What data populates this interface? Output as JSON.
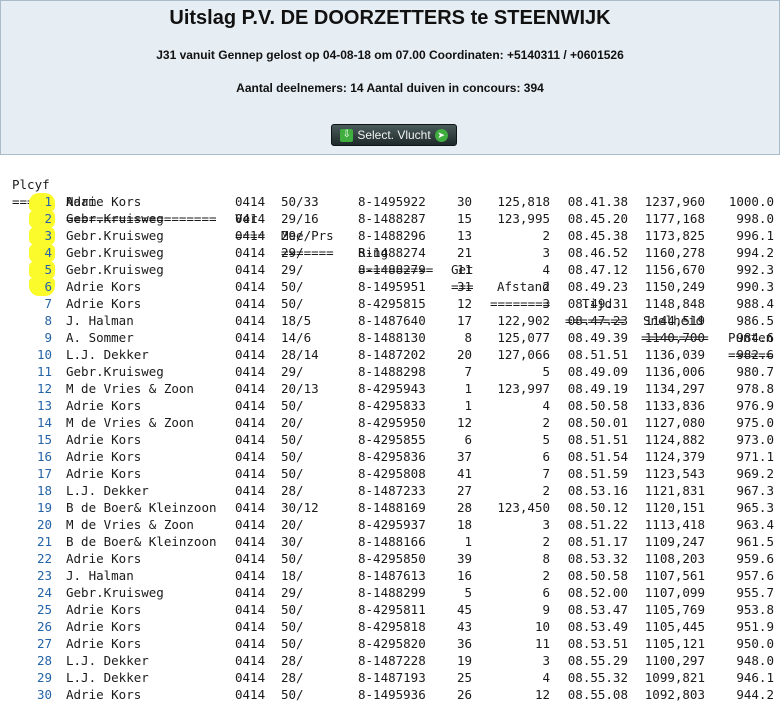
{
  "header": {
    "title": "Uitslag P.V. DE DOORZETTERS te STEENWIJK",
    "flight_info": "J31 vanuit Gennep gelost op 04-08-18 om 07.00 Coordinaten: +5140311 / +0601526",
    "participants": "Aantal deelnemers: 14 Aantal duiven in concours: 394"
  },
  "toolbar": {
    "select_label": "Select. Vlucht"
  },
  "table": {
    "headers": {
      "plcyf": "Plcyf",
      "naam": "Naam",
      "ver": "Ver",
      "mee": "Mee/Prs",
      "ring": "Ring",
      "get": "Get",
      "afstand": "Afstand",
      "tijd": "Tijd",
      "snelheid": "Snelheid",
      "punten": "Punten"
    },
    "separators": {
      "plcyf": "=====",
      "naam": "====================",
      "ver": "====",
      "mee": "=======",
      "ring": "==========",
      "get": "===",
      "afstand": "========",
      "tijd": "========",
      "snelheid": "=========",
      "punten": "======"
    },
    "rows": [
      {
        "rank": "1",
        "naam": "Adrie Kors",
        "ver": "0414",
        "mee": "50/33",
        "ring": "8-1495922",
        "get": "30",
        "afstand": "125,818",
        "tijd": "08.41.38",
        "snelheid": "1237,960",
        "punten": "1000.0"
      },
      {
        "rank": "2",
        "naam": "Gebr.Kruisweg",
        "ver": "0414",
        "mee": "29/16",
        "ring": "8-1488287",
        "get": "15",
        "afstand": "123,995",
        "tijd": "08.45.20",
        "snelheid": "1177,168",
        "punten": "998.0"
      },
      {
        "rank": "3",
        "naam": "Gebr.Kruisweg",
        "ver": "0414",
        "mee": "29/",
        "ring": "8-1488296",
        "get": "13",
        "afstand": "2",
        "tijd": "08.45.38",
        "snelheid": "1173,825",
        "punten": "996.1"
      },
      {
        "rank": "4",
        "naam": "Gebr.Kruisweg",
        "ver": "0414",
        "mee": "29/",
        "ring": "8-1488274",
        "get": "21",
        "afstand": "3",
        "tijd": "08.46.52",
        "snelheid": "1160,278",
        "punten": "994.2"
      },
      {
        "rank": "5",
        "naam": "Gebr.Kruisweg",
        "ver": "0414",
        "mee": "29/",
        "ring": "8-1488279",
        "get": "11",
        "afstand": "4",
        "tijd": "08.47.12",
        "snelheid": "1156,670",
        "punten": "992.3"
      },
      {
        "rank": "6",
        "naam": "Adrie Kors",
        "ver": "0414",
        "mee": "50/",
        "ring": "8-1495951",
        "get": "31",
        "afstand": "2",
        "tijd": "08.49.23",
        "snelheid": "1150,249",
        "punten": "990.3"
      },
      {
        "rank": "7",
        "naam": "Adrie Kors",
        "ver": "0414",
        "mee": "50/",
        "ring": "8-4295815",
        "get": "12",
        "afstand": "3",
        "tijd": "08.49.31",
        "snelheid": "1148,848",
        "punten": "988.4"
      },
      {
        "rank": "8",
        "naam": "J. Halman",
        "ver": "0414",
        "mee": "18/5",
        "ring": "8-1487640",
        "get": "17",
        "afstand": "122,902",
        "tijd": "08.47.23",
        "snelheid": "1144,519",
        "punten": "986.5"
      },
      {
        "rank": "9",
        "naam": "A. Sommer",
        "ver": "0414",
        "mee": "14/6",
        "ring": "8-1488130",
        "get": "8",
        "afstand": "125,077",
        "tijd": "08.49.39",
        "snelheid": "1140,700",
        "punten": "984.6"
      },
      {
        "rank": "10",
        "naam": "L.J. Dekker",
        "ver": "0414",
        "mee": "28/14",
        "ring": "8-1487202",
        "get": "20",
        "afstand": "127,066",
        "tijd": "08.51.51",
        "snelheid": "1136,039",
        "punten": "982.6"
      },
      {
        "rank": "11",
        "naam": "Gebr.Kruisweg",
        "ver": "0414",
        "mee": "29/",
        "ring": "8-1488298",
        "get": "7",
        "afstand": "5",
        "tijd": "08.49.09",
        "snelheid": "1136,006",
        "punten": "980.7"
      },
      {
        "rank": "12",
        "naam": "M de Vries & Zoon",
        "ver": "0414",
        "mee": "20/13",
        "ring": "8-4295943",
        "get": "1",
        "afstand": "123,997",
        "tijd": "08.49.19",
        "snelheid": "1134,297",
        "punten": "978.8"
      },
      {
        "rank": "13",
        "naam": "Adrie Kors",
        "ver": "0414",
        "mee": "50/",
        "ring": "8-4295833",
        "get": "1",
        "afstand": "4",
        "tijd": "08.50.58",
        "snelheid": "1133,836",
        "punten": "976.9"
      },
      {
        "rank": "14",
        "naam": "M de Vries & Zoon",
        "ver": "0414",
        "mee": "20/",
        "ring": "8-4295950",
        "get": "12",
        "afstand": "2",
        "tijd": "08.50.01",
        "snelheid": "1127,080",
        "punten": "975.0"
      },
      {
        "rank": "15",
        "naam": "Adrie Kors",
        "ver": "0414",
        "mee": "50/",
        "ring": "8-4295855",
        "get": "6",
        "afstand": "5",
        "tijd": "08.51.51",
        "snelheid": "1124,882",
        "punten": "973.0"
      },
      {
        "rank": "16",
        "naam": "Adrie Kors",
        "ver": "0414",
        "mee": "50/",
        "ring": "8-4295836",
        "get": "37",
        "afstand": "6",
        "tijd": "08.51.54",
        "snelheid": "1124,379",
        "punten": "971.1"
      },
      {
        "rank": "17",
        "naam": "Adrie Kors",
        "ver": "0414",
        "mee": "50/",
        "ring": "8-4295808",
        "get": "41",
        "afstand": "7",
        "tijd": "08.51.59",
        "snelheid": "1123,543",
        "punten": "969.2"
      },
      {
        "rank": "18",
        "naam": "L.J. Dekker",
        "ver": "0414",
        "mee": "28/",
        "ring": "8-1487233",
        "get": "27",
        "afstand": "2",
        "tijd": "08.53.16",
        "snelheid": "1121,831",
        "punten": "967.3"
      },
      {
        "rank": "19",
        "naam": "B de Boer& Kleinzoon",
        "ver": "0414",
        "mee": "30/12",
        "ring": "8-1488169",
        "get": "28",
        "afstand": "123,450",
        "tijd": "08.50.12",
        "snelheid": "1120,151",
        "punten": "965.3"
      },
      {
        "rank": "20",
        "naam": "M de Vries & Zoon",
        "ver": "0414",
        "mee": "20/",
        "ring": "8-4295937",
        "get": "18",
        "afstand": "3",
        "tijd": "08.51.22",
        "snelheid": "1113,418",
        "punten": "963.4"
      },
      {
        "rank": "21",
        "naam": "B de Boer& Kleinzoon",
        "ver": "0414",
        "mee": "30/",
        "ring": "8-1488166",
        "get": "1",
        "afstand": "2",
        "tijd": "08.51.17",
        "snelheid": "1109,247",
        "punten": "961.5"
      },
      {
        "rank": "22",
        "naam": "Adrie Kors",
        "ver": "0414",
        "mee": "50/",
        "ring": "8-4295850",
        "get": "39",
        "afstand": "8",
        "tijd": "08.53.32",
        "snelheid": "1108,203",
        "punten": "959.6"
      },
      {
        "rank": "23",
        "naam": "J. Halman",
        "ver": "0414",
        "mee": "18/",
        "ring": "8-1487613",
        "get": "16",
        "afstand": "2",
        "tijd": "08.50.58",
        "snelheid": "1107,561",
        "punten": "957.6"
      },
      {
        "rank": "24",
        "naam": "Gebr.Kruisweg",
        "ver": "0414",
        "mee": "29/",
        "ring": "8-1488299",
        "get": "5",
        "afstand": "6",
        "tijd": "08.52.00",
        "snelheid": "1107,099",
        "punten": "955.7"
      },
      {
        "rank": "25",
        "naam": "Adrie Kors",
        "ver": "0414",
        "mee": "50/",
        "ring": "8-4295811",
        "get": "45",
        "afstand": "9",
        "tijd": "08.53.47",
        "snelheid": "1105,769",
        "punten": "953.8"
      },
      {
        "rank": "26",
        "naam": "Adrie Kors",
        "ver": "0414",
        "mee": "50/",
        "ring": "8-4295818",
        "get": "43",
        "afstand": "10",
        "tijd": "08.53.49",
        "snelheid": "1105,445",
        "punten": "951.9"
      },
      {
        "rank": "27",
        "naam": "Adrie Kors",
        "ver": "0414",
        "mee": "50/",
        "ring": "8-4295820",
        "get": "36",
        "afstand": "11",
        "tijd": "08.53.51",
        "snelheid": "1105,121",
        "punten": "950.0"
      },
      {
        "rank": "28",
        "naam": "L.J. Dekker",
        "ver": "0414",
        "mee": "28/",
        "ring": "8-1487228",
        "get": "19",
        "afstand": "3",
        "tijd": "08.55.29",
        "snelheid": "1100,297",
        "punten": "948.0"
      },
      {
        "rank": "29",
        "naam": "L.J. Dekker",
        "ver": "0414",
        "mee": "28/",
        "ring": "8-1487193",
        "get": "25",
        "afstand": "4",
        "tijd": "08.55.32",
        "snelheid": "1099,821",
        "punten": "946.1"
      },
      {
        "rank": "30",
        "naam": "Adrie Kors",
        "ver": "0414",
        "mee": "50/",
        "ring": "8-1495936",
        "get": "26",
        "afstand": "12",
        "tijd": "08.55.08",
        "snelheid": "1092,803",
        "punten": "944.2"
      }
    ]
  },
  "colors": {
    "header_bg": "#e6edf3",
    "rank_link": "#2563a8",
    "highlight": "#fbfb2c",
    "button_bg": "#2d3a3a",
    "button_icon": "#3fae3f"
  }
}
